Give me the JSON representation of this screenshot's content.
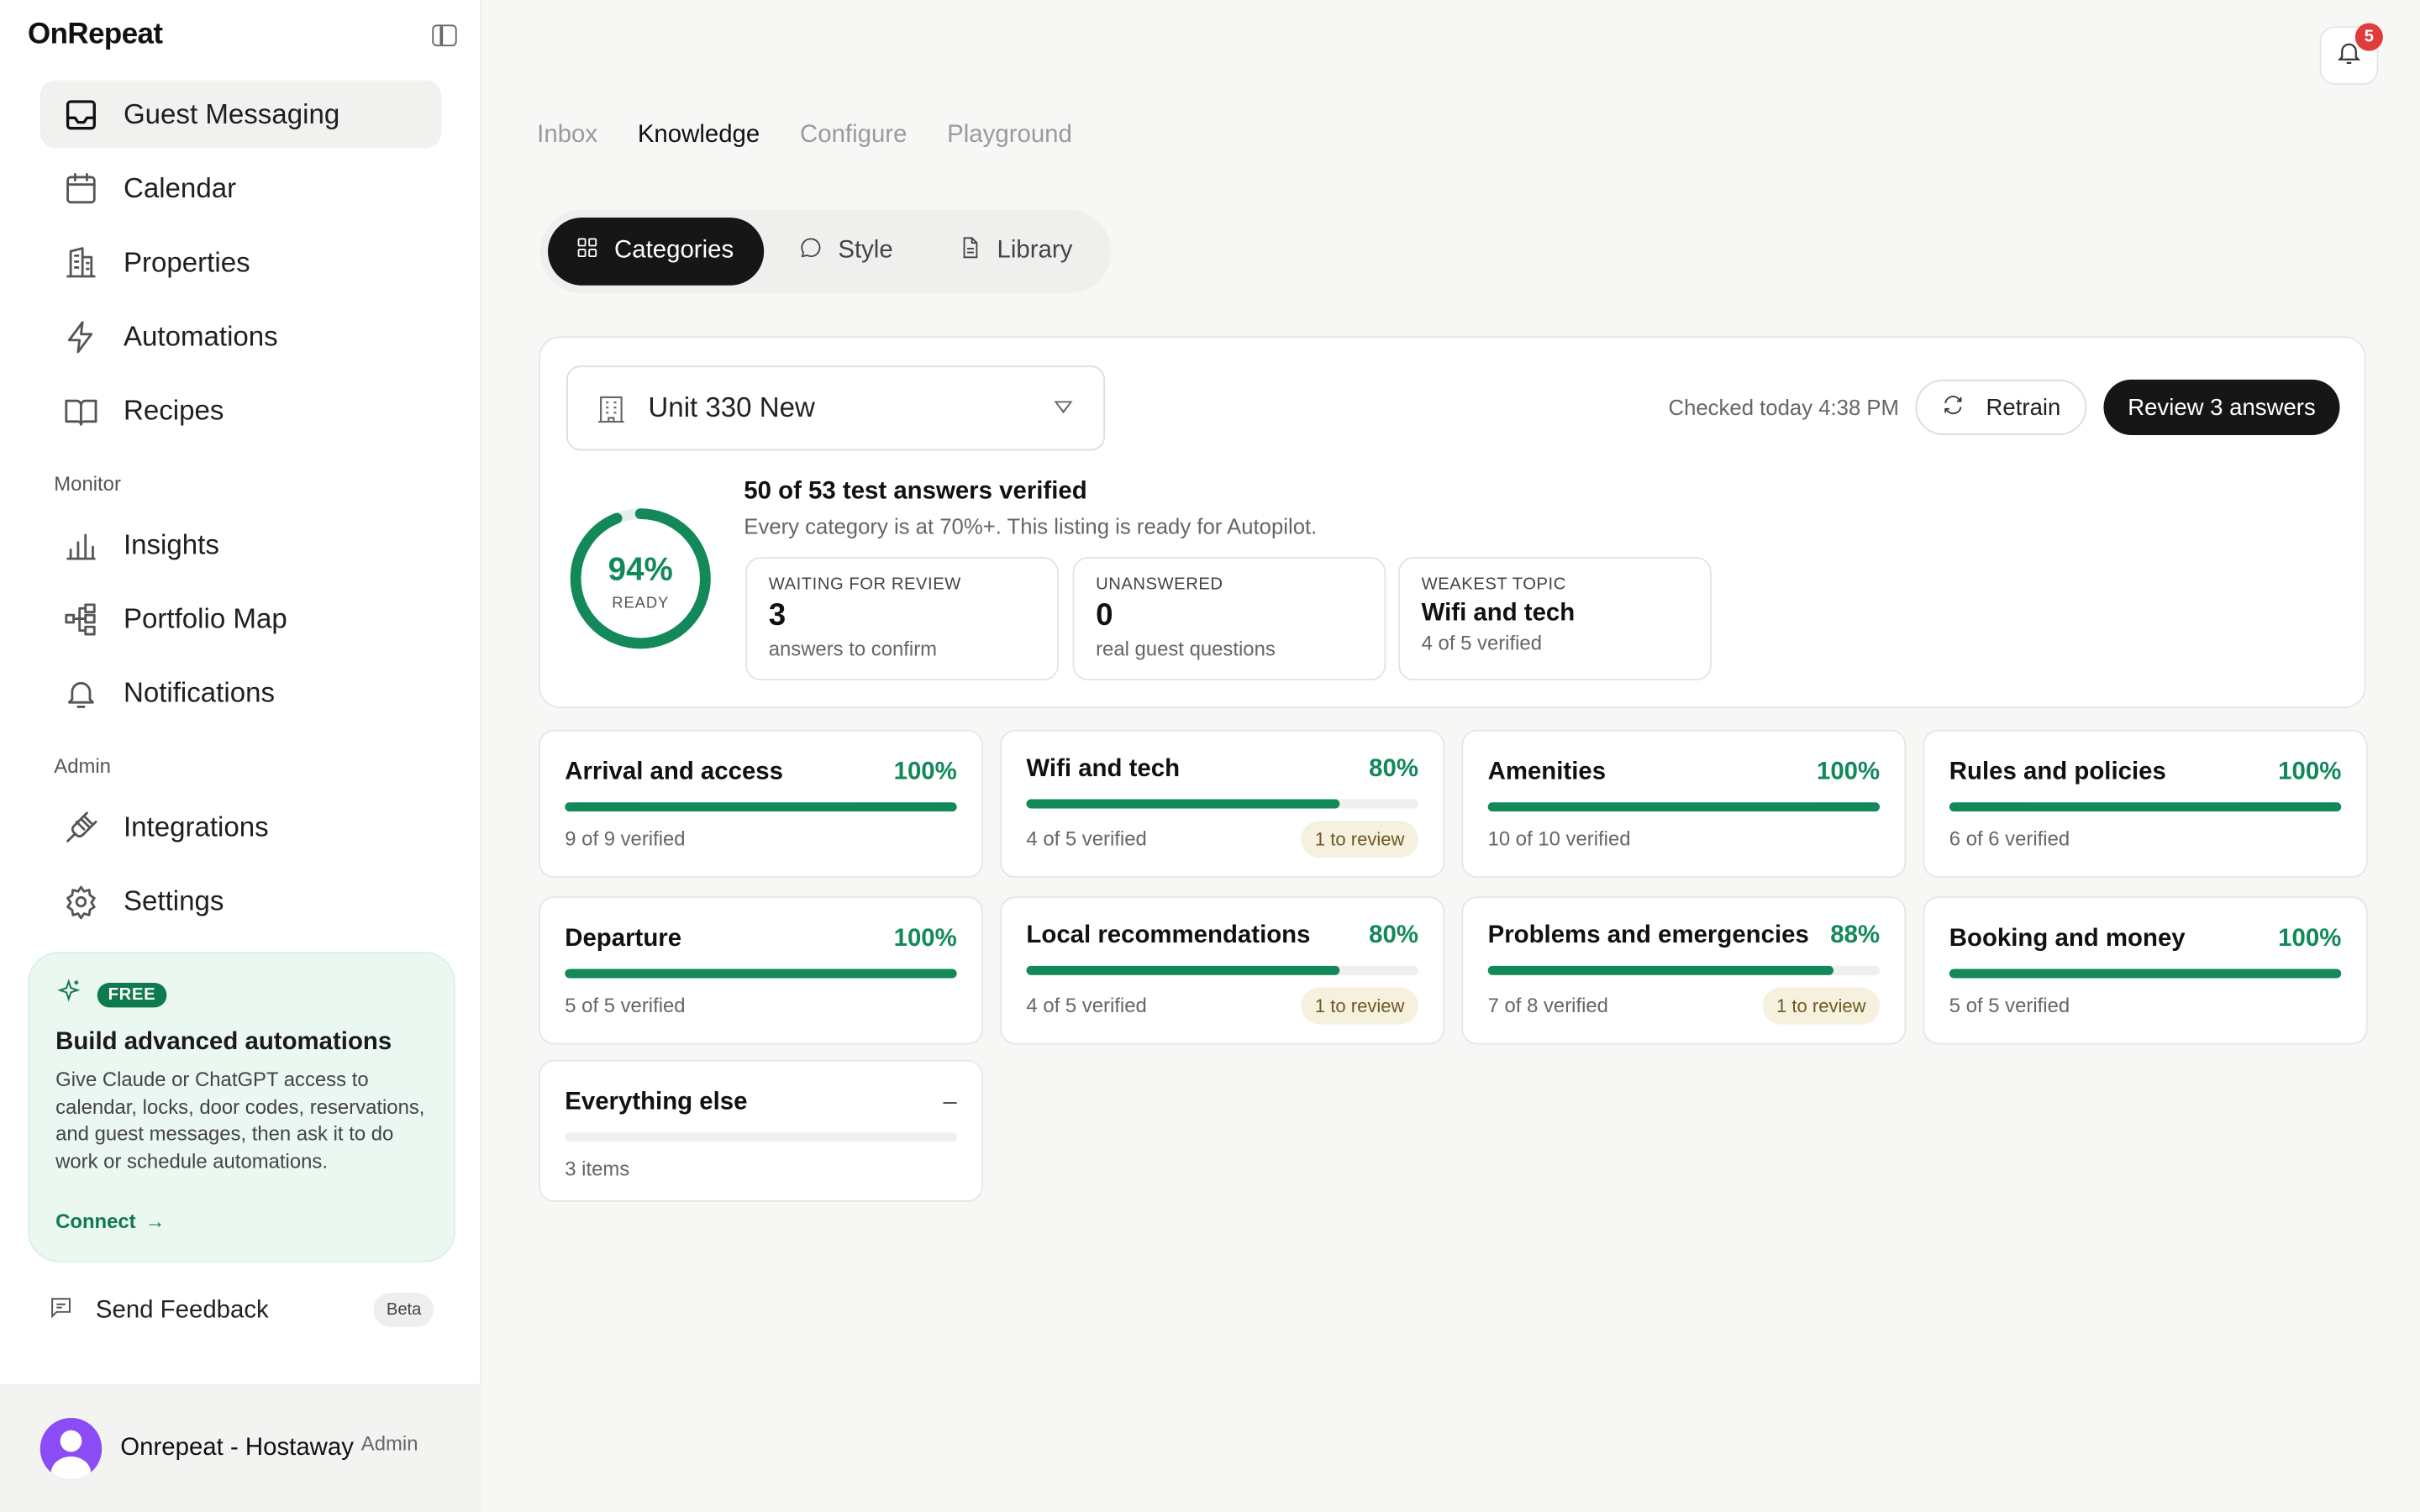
{
  "sidebar": {
    "brand": "OnRepeat",
    "nav": [
      {
        "label": "Guest Messaging",
        "icon": "inbox-icon",
        "active": true
      },
      {
        "label": "Calendar",
        "icon": "calendar-icon"
      },
      {
        "label": "Properties",
        "icon": "building-icon"
      },
      {
        "label": "Automations",
        "icon": "lightning-icon"
      },
      {
        "label": "Recipes",
        "icon": "book-icon"
      }
    ],
    "monitor_label": "Monitor",
    "monitor": [
      {
        "label": "Insights",
        "icon": "bar-chart-icon"
      },
      {
        "label": "Portfolio Map",
        "icon": "network-icon"
      },
      {
        "label": "Notifications",
        "icon": "bell-icon"
      }
    ],
    "admin_label": "Admin",
    "admin": [
      {
        "label": "Integrations",
        "icon": "plug-icon"
      },
      {
        "label": "Settings",
        "icon": "gear-icon"
      }
    ],
    "promo": {
      "badge": "FREE",
      "title": "Build advanced automations",
      "body": "Give Claude or ChatGPT access to calendar, locks, door codes, reservations, and guest messages, then ask it to do work or schedule automations.",
      "link": "Connect"
    },
    "feedback": {
      "label": "Send Feedback",
      "badge": "Beta"
    },
    "user": {
      "name": "Onrepeat - Hostaway",
      "role": "Admin"
    }
  },
  "header": {
    "notification_count": "5",
    "tabs": [
      "Inbox",
      "Knowledge",
      "Configure",
      "Playground"
    ],
    "active_tab": "Knowledge"
  },
  "segments": [
    {
      "label": "Categories",
      "icon": "grid-icon",
      "active": true
    },
    {
      "label": "Style",
      "icon": "chat-bubble-icon"
    },
    {
      "label": "Library",
      "icon": "document-icon"
    }
  ],
  "summary": {
    "unit": "Unit 330 New",
    "checked": "Checked today 4:38 PM",
    "retrain": "Retrain",
    "review": "Review 3 answers",
    "readiness_pct": "94%",
    "readiness_value": 0.94,
    "readiness_label": "READY",
    "verified_title": "50 of 53 test answers verified",
    "verified_sub": "Every category is at 70%+. This listing is ready for Autopilot.",
    "stats": [
      {
        "label": "WAITING FOR REVIEW",
        "value": "3",
        "sub": "answers to confirm"
      },
      {
        "label": "UNANSWERED",
        "value": "0",
        "sub": "real guest questions"
      },
      {
        "label": "WEAKEST TOPIC",
        "value": "Wifi and tech",
        "sub": "4 of 5 verified"
      }
    ]
  },
  "categories": [
    {
      "title": "Arrival and access",
      "pct": "100%",
      "fill": 1.0,
      "sub": "9 of 9 verified",
      "review": ""
    },
    {
      "title": "Wifi and tech",
      "pct": "80%",
      "fill": 0.8,
      "sub": "4 of 5 verified",
      "review": "1 to review"
    },
    {
      "title": "Amenities",
      "pct": "100%",
      "fill": 1.0,
      "sub": "10 of 10 verified",
      "review": ""
    },
    {
      "title": "Rules and policies",
      "pct": "100%",
      "fill": 1.0,
      "sub": "6 of 6 verified",
      "review": ""
    },
    {
      "title": "Departure",
      "pct": "100%",
      "fill": 1.0,
      "sub": "5 of 5 verified",
      "review": ""
    },
    {
      "title": "Local recommendations",
      "pct": "80%",
      "fill": 0.8,
      "sub": "4 of 5 verified",
      "review": "1 to review"
    },
    {
      "title": "Problems and emergencies",
      "pct": "88%",
      "fill": 0.88,
      "sub": "7 of 8 verified",
      "review": "1 to review"
    },
    {
      "title": "Booking and money",
      "pct": "100%",
      "fill": 1.0,
      "sub": "5 of 5 verified",
      "review": ""
    },
    {
      "title": "Everything else",
      "pct": "–",
      "fill": 0,
      "sub": "3 items",
      "review": ""
    }
  ],
  "colors": {
    "accent": "#13895a",
    "dark": "#161616",
    "badge": "#e23b3b",
    "promo_bg": "#ebf8f1"
  }
}
